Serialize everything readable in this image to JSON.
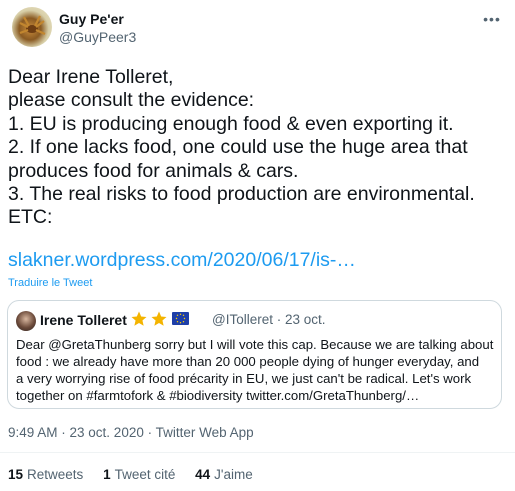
{
  "tweet": {
    "author_name": "Guy Pe'er",
    "author_handle": "@GuyPeer3",
    "more_icon": "more-dots-icon",
    "text_lines": [
      "Dear Irene Tolleret,",
      "please consult the evidence:",
      "1. EU is producing enough food & even exporting it.",
      "2. If one lacks food, one could use the huge area that",
      "produces food for animals & cars.",
      "3. The real risks to food production are environmental.",
      "ETC:"
    ],
    "link": "slakner.wordpress.com/2020/06/17/is-…",
    "translate": "Traduire le Tweet",
    "link_color": "#1d9bf0"
  },
  "quote": {
    "name": "Irene Tolleret",
    "badges": [
      "star-icon",
      "star-icon",
      "eu-flag-icon"
    ],
    "handle_date": "@ITolleret · 23 oct.",
    "text_lines": [
      "Dear @GretaThunberg sorry but I will vote this cap. Because we are talking about",
      "food : we already have more than 20 000 people dying of hunger everyday, and",
      "a very worrying rise of food précarity in EU, we just can't be radical. Let's work",
      "together on #farmtofork & #biodiversity twitter.com/GretaThunberg/…"
    ]
  },
  "meta": "9:49 AM · 23 oct. 2020 · Twitter Web App",
  "stats": {
    "retweets_count": "15",
    "retweets_label": "Retweets",
    "quotes_count": "1",
    "quotes_label": "Tweet cité",
    "likes_count": "44",
    "likes_label": "J'aime"
  }
}
